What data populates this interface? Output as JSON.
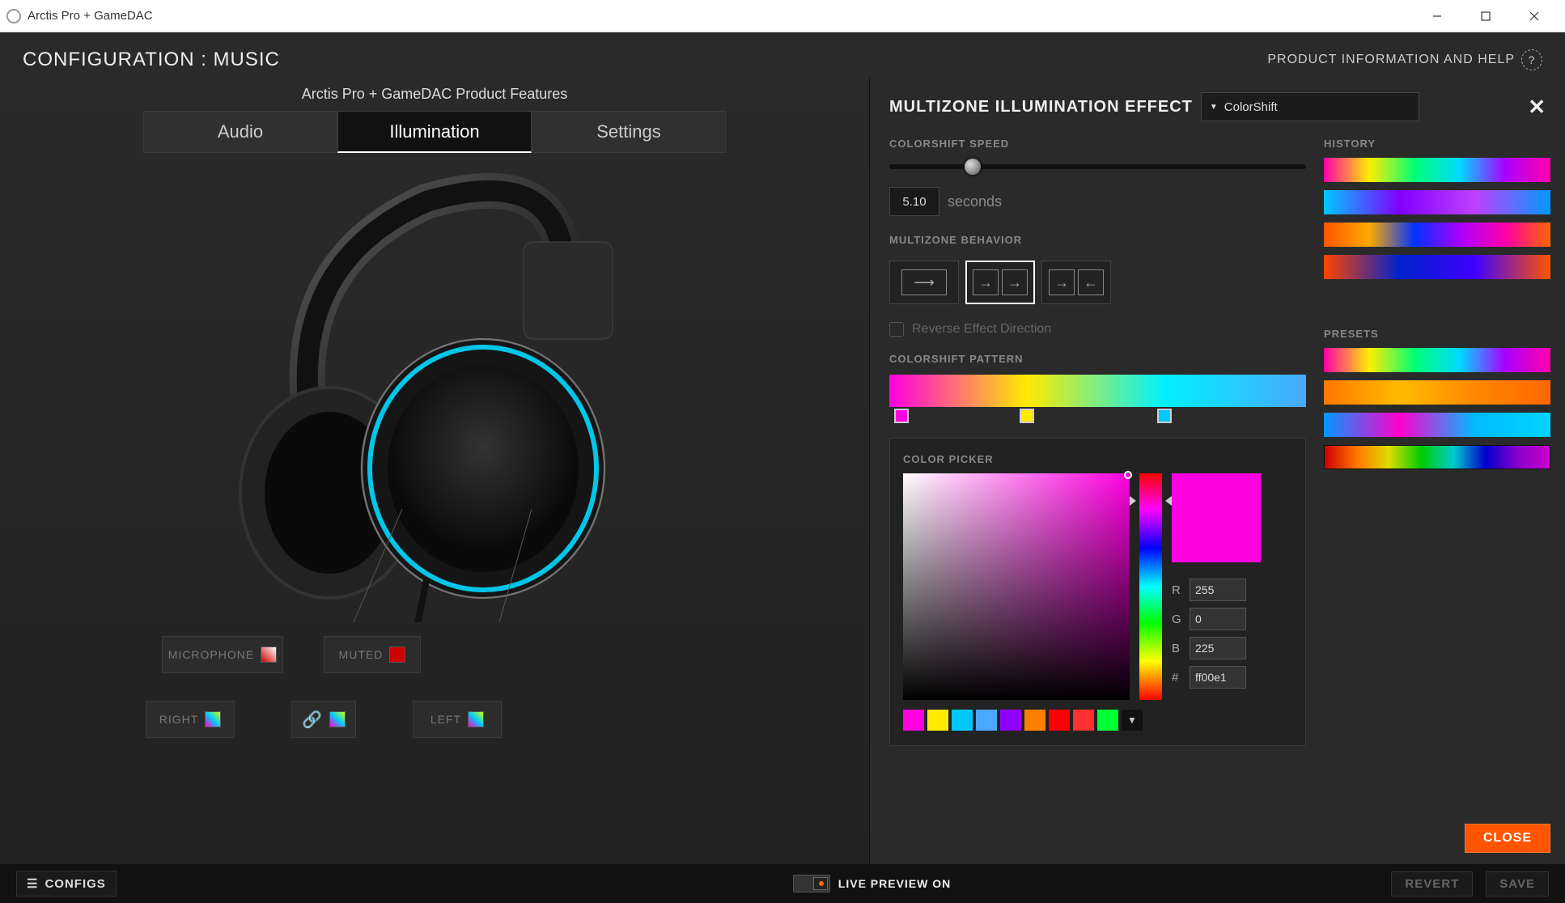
{
  "window": {
    "title": "Arctis Pro + GameDAC"
  },
  "header": {
    "config_title": "CONFIGURATION : MUSIC",
    "help": "PRODUCT INFORMATION AND HELP"
  },
  "product_features_label": "Arctis Pro + GameDAC Product Features",
  "tabs": {
    "audio": "Audio",
    "illumination": "Illumination",
    "settings": "Settings",
    "active": "illumination"
  },
  "zones": {
    "microphone": "MICROPHONE",
    "muted": "MUTED",
    "right": "RIGHT",
    "left": "LEFT"
  },
  "panel": {
    "title": "MULTIZONE ILLUMINATION EFFECT",
    "effect_selected": "ColorShift",
    "speed_label": "COLORSHIFT SPEED",
    "speed_value": "5.10",
    "speed_unit": "seconds",
    "behavior_label": "MULTIZONE BEHAVIOR",
    "reverse_label": "Reverse Effect Direction",
    "pattern_label": "COLORSHIFT PATTERN",
    "picker_label": "COLOR PICKER",
    "rgb": {
      "r": "255",
      "g": "0",
      "b": "225",
      "hex": "ff00e1"
    },
    "swatches": [
      "#ff00e1",
      "#ffeb00",
      "#00c8ff",
      "#4aa8ff",
      "#9000ff",
      "#ff8000",
      "#ff0000",
      "#ff3030",
      "#00ff33"
    ],
    "close": "CLOSE"
  },
  "side": {
    "history_label": "HISTORY",
    "presets_label": "PRESETS"
  },
  "footer": {
    "configs": "CONFIGS",
    "live_preview": "LIVE PREVIEW ON",
    "revert": "REVERT",
    "save": "SAVE"
  }
}
